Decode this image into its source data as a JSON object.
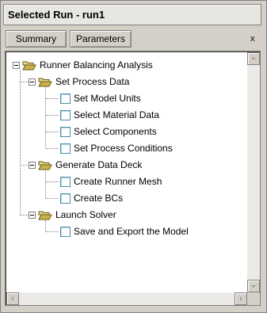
{
  "panel": {
    "title": "Selected Run - run1",
    "close_label": "x",
    "tabs": [
      {
        "label": "Summary"
      },
      {
        "label": "Parameters"
      }
    ]
  },
  "tree": {
    "root": {
      "label": "Runner Balancing Analysis",
      "icon": "open-folder-icon",
      "groups": [
        {
          "label": "Set Process Data",
          "icon": "open-folder-icon",
          "items": [
            "Set Model Units",
            "Select Material Data",
            "Select Components",
            "Set Process Conditions"
          ]
        },
        {
          "label": "Generate Data Deck",
          "icon": "open-folder-icon",
          "items": [
            "Create Runner Mesh",
            "Create BCs"
          ]
        },
        {
          "label": "Launch Solver",
          "icon": "open-folder-icon",
          "items": [
            "Save and Export the Model"
          ]
        }
      ]
    }
  },
  "colors": {
    "panel_bg": "#d4d0c8",
    "tree_bg": "#ffffff",
    "checkbox_border": "#4a8fa8",
    "folder_fill": "#c9b24a"
  }
}
